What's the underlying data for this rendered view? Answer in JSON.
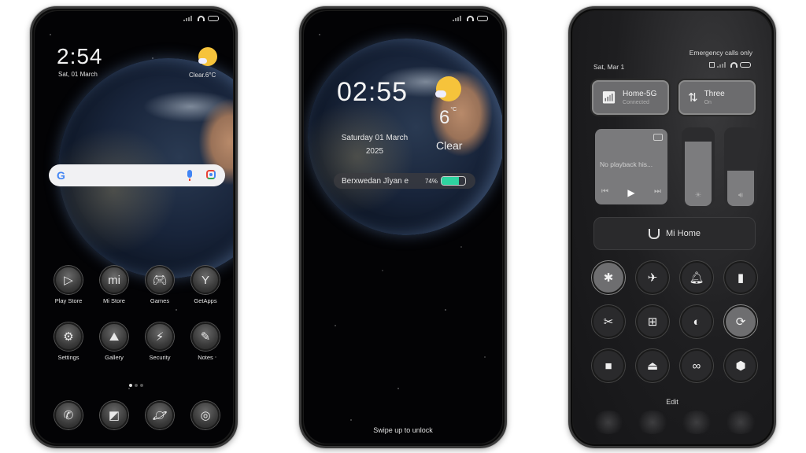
{
  "home_screen": {
    "clock": "2:54",
    "date": "Sat, 01 March",
    "weather": "Clear.6°C",
    "search_logo": "G",
    "apps_row1": [
      {
        "label": "Play Store",
        "icon": "▷",
        "name": "play-store"
      },
      {
        "label": "Mi Store",
        "icon": "mi",
        "name": "mi-store"
      },
      {
        "label": "Games",
        "icon": "🎮︎",
        "name": "games"
      },
      {
        "label": "GetApps",
        "icon": "Y",
        "name": "getapps"
      }
    ],
    "apps_row2": [
      {
        "label": "Settings",
        "icon": "⚙",
        "name": "settings"
      },
      {
        "label": "Gallery",
        "icon": "⛰",
        "name": "gallery"
      },
      {
        "label": "Security",
        "icon": "⚡",
        "name": "security"
      },
      {
        "label": "Notes",
        "icon": "✎",
        "name": "notes"
      }
    ],
    "dock": [
      {
        "icon": "✆",
        "name": "phone"
      },
      {
        "icon": "◩",
        "name": "messages"
      },
      {
        "icon": "🪐︎",
        "name": "browser"
      },
      {
        "icon": "◎",
        "name": "camera"
      }
    ]
  },
  "lock_screen": {
    "clock": "02:55",
    "date_line1": "Saturday 01 March",
    "date_line2": "2025",
    "temperature": "6",
    "temp_unit": "°C",
    "condition": "Clear",
    "battery_label": "Berxwedan Jîyan e",
    "battery_percent_text": "74%",
    "battery_level": 0.74,
    "battery_color": "#2ed3a0",
    "swipe_hint": "Swipe up to unlock"
  },
  "control_center": {
    "emergency": "Emergency calls only",
    "date": "Sat, Mar 1",
    "wifi_tile": {
      "title": "Home-5G",
      "subtitle": "Connected",
      "icon": "wifi-icon"
    },
    "data_tile": {
      "title": "Three",
      "subtitle": "On",
      "icon": "mobile-data-icon"
    },
    "media": {
      "text": "No playback his..."
    },
    "brightness_level": 0.82,
    "volume_level": 0.45,
    "mi_home_label": "Mi Home",
    "toggles_row1": [
      {
        "icon": "✱",
        "name": "bluetooth",
        "on": true
      },
      {
        "icon": "✈",
        "name": "airplane",
        "on": false
      },
      {
        "icon": "🔔︎",
        "name": "bell",
        "on": false
      },
      {
        "icon": "▮",
        "name": "flashlight",
        "on": false
      }
    ],
    "toggles_row2": [
      {
        "icon": "✂",
        "name": "screenshot",
        "on": false
      },
      {
        "icon": "⊞",
        "name": "battery-saver",
        "on": false
      },
      {
        "icon": "◐",
        "name": "dark-mode",
        "on": false
      },
      {
        "icon": "⟳",
        "name": "rotation-lock",
        "on": true
      }
    ],
    "toggles_row3": [
      {
        "icon": "■",
        "name": "screen-record",
        "on": false
      },
      {
        "icon": "⏏",
        "name": "cast",
        "on": false
      },
      {
        "icon": "∞",
        "name": "link",
        "on": false
      },
      {
        "icon": "⬢",
        "name": "settings-hex",
        "on": false
      }
    ],
    "edit_label": "Edit"
  }
}
